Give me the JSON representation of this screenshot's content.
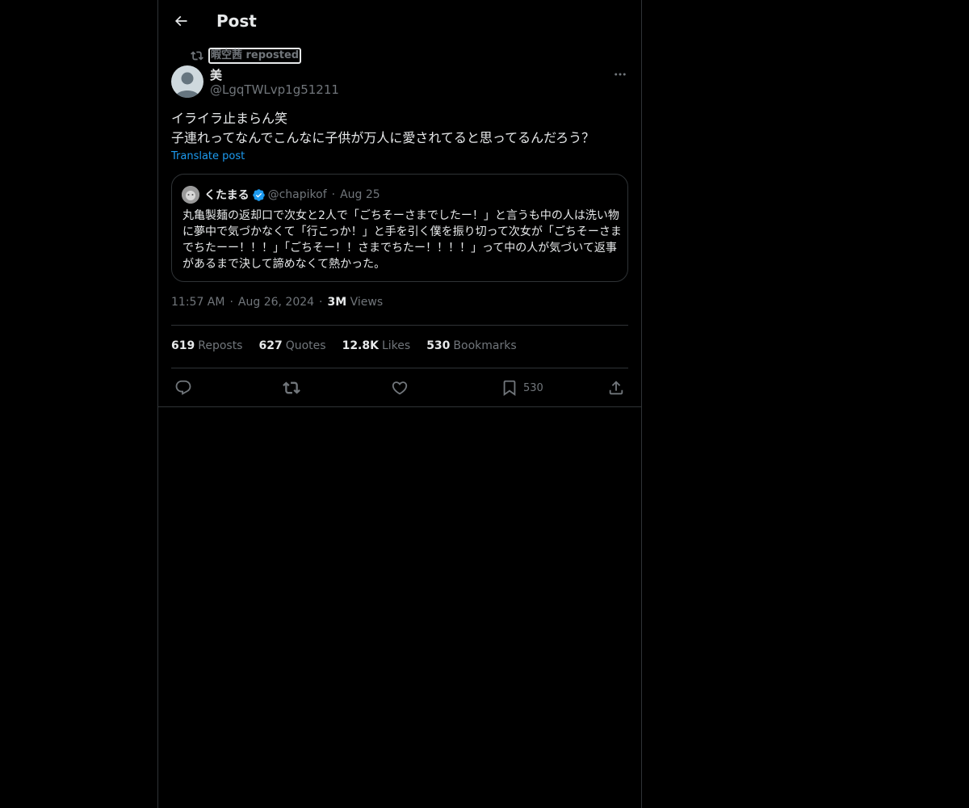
{
  "header": {
    "title": "Post",
    "back_icon": "arrow-left-icon"
  },
  "repost": {
    "icon": "repost-icon",
    "label": "暇空茜 reposted"
  },
  "post": {
    "author_name": "美",
    "author_handle": "@LgqTWLvp1g51211",
    "lines": [
      "イライラ止まらん笑",
      "子連れってなんでこんなに子供が万人に愛されてると思ってるんだろう？"
    ],
    "translate_label": "Translate post",
    "time": "11:57 AM",
    "date": "Aug 26, 2024",
    "views_count": "3M",
    "views_label": "Views"
  },
  "quote": {
    "name": "くたまる",
    "handle": "@chapikof",
    "separator": "·",
    "date": "Aug 25",
    "text": "丸亀製麺の返却口で次女と2人で「ごちそーさまでしたー！」と言うも中の人は洗い物に夢中で気づかなくて「行こっか！」と手を引く僕を振り切って次女が「ごちそーさまでちたーー！！！」「ごちそー！！さまでちたー！！！！」って中の人が気づいて返事があるまで決して諦めなくて熱かった。"
  },
  "stats": {
    "reposts_count": "619",
    "reposts_label": "Reposts",
    "quotes_count": "627",
    "quotes_label": "Quotes",
    "likes_count": "12.8K",
    "likes_label": "Likes",
    "bookmarks_count": "530",
    "bookmarks_label": "Bookmarks"
  },
  "actions": {
    "reply_icon": "reply-icon",
    "repost_icon": "repost-icon",
    "like_icon": "heart-icon",
    "bookmark_icon": "bookmark-icon",
    "bookmark_count": "530",
    "share_icon": "share-icon"
  },
  "colors": {
    "background": "#000000",
    "text": "#e7e9ea",
    "muted": "#71767b",
    "accent": "#1d9bf0",
    "border": "#2f3336"
  }
}
